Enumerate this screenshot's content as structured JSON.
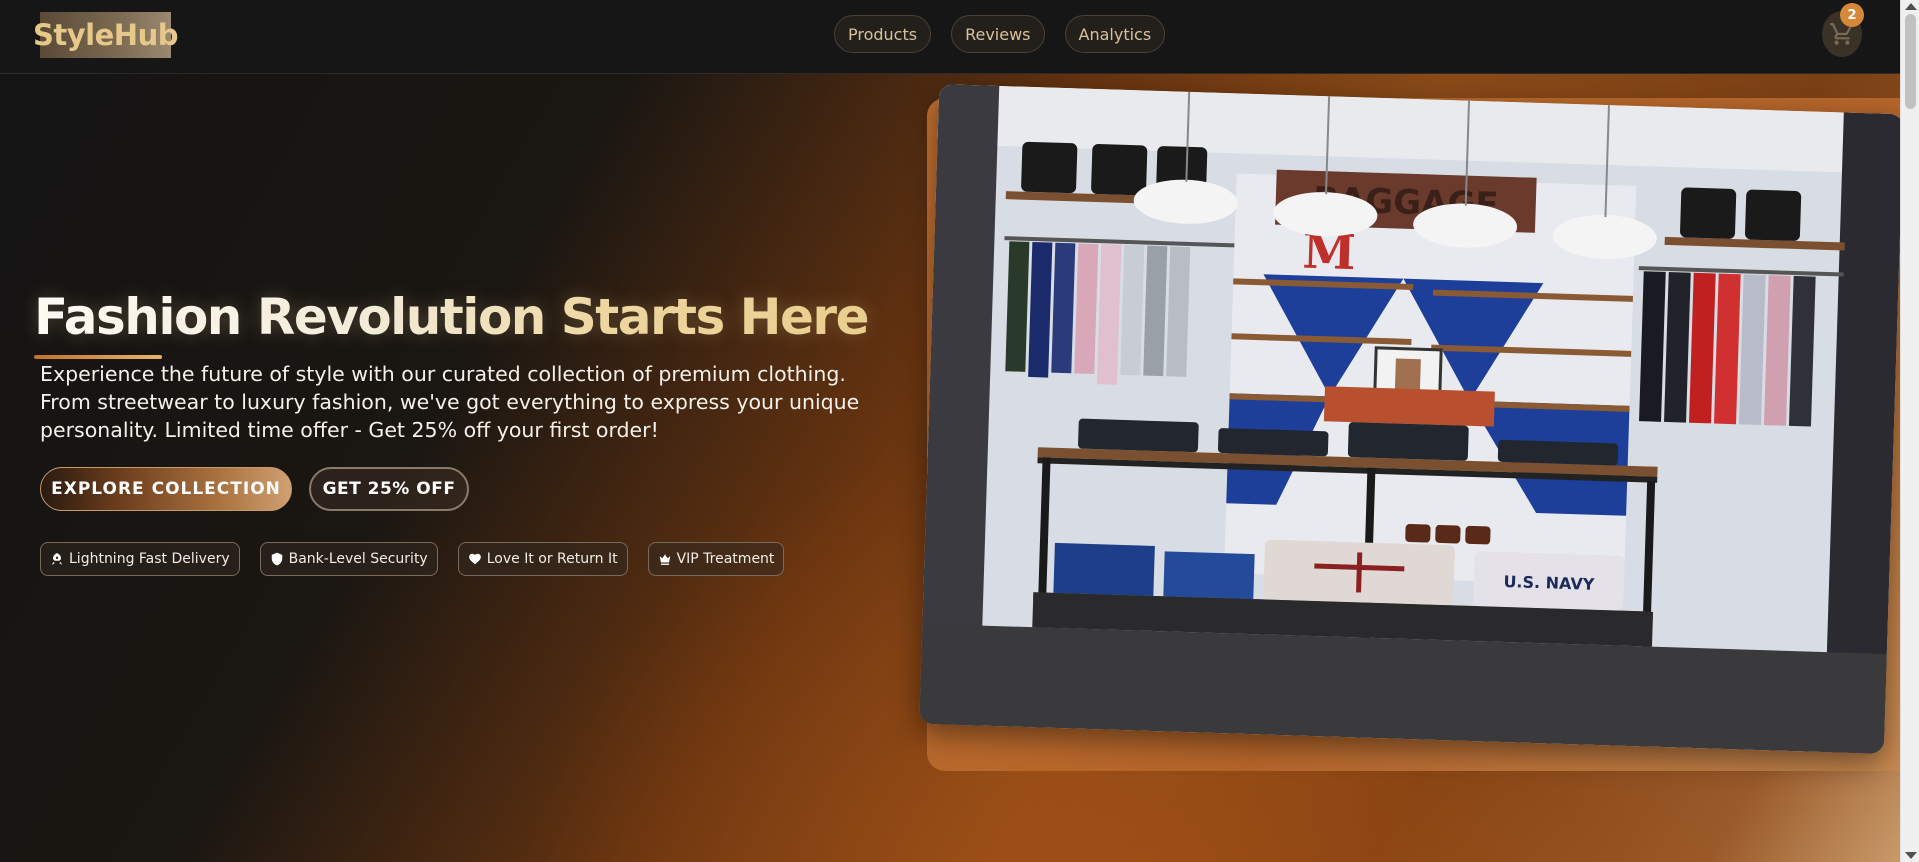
{
  "navbar": {
    "logo_text": "StyleHub",
    "links": [
      {
        "label": "Products"
      },
      {
        "label": "Reviews"
      },
      {
        "label": "Analytics"
      }
    ],
    "cart_icon": "shopping-cart-icon",
    "cart_count": "2"
  },
  "hero": {
    "title": "Fashion Revolution Starts Here",
    "description": "Experience the future of style with our curated collection of premium clothing. From streetwear to luxury fashion, we've got everything to express your unique personality. Limited time offer - Get 25% off your first order!",
    "primary_button": "EXPLORE COLLECTION",
    "secondary_button": "GET 25% OFF",
    "features": [
      {
        "icon": "rocket-icon",
        "label": "Lightning Fast Delivery"
      },
      {
        "icon": "shield-icon",
        "label": "Bank-Level Security"
      },
      {
        "icon": "heart-icon",
        "label": "Love It or Return It"
      },
      {
        "icon": "crown-icon",
        "label": "VIP Treatment"
      }
    ],
    "image_labels": {
      "store_sign": "BAGGAGE",
      "letter_sign": "M",
      "sweater_text": "U.S. NAVY"
    }
  },
  "colors": {
    "accent": "#d6883a",
    "logo": "#e6c88a",
    "nav_text": "#d9c09a"
  }
}
